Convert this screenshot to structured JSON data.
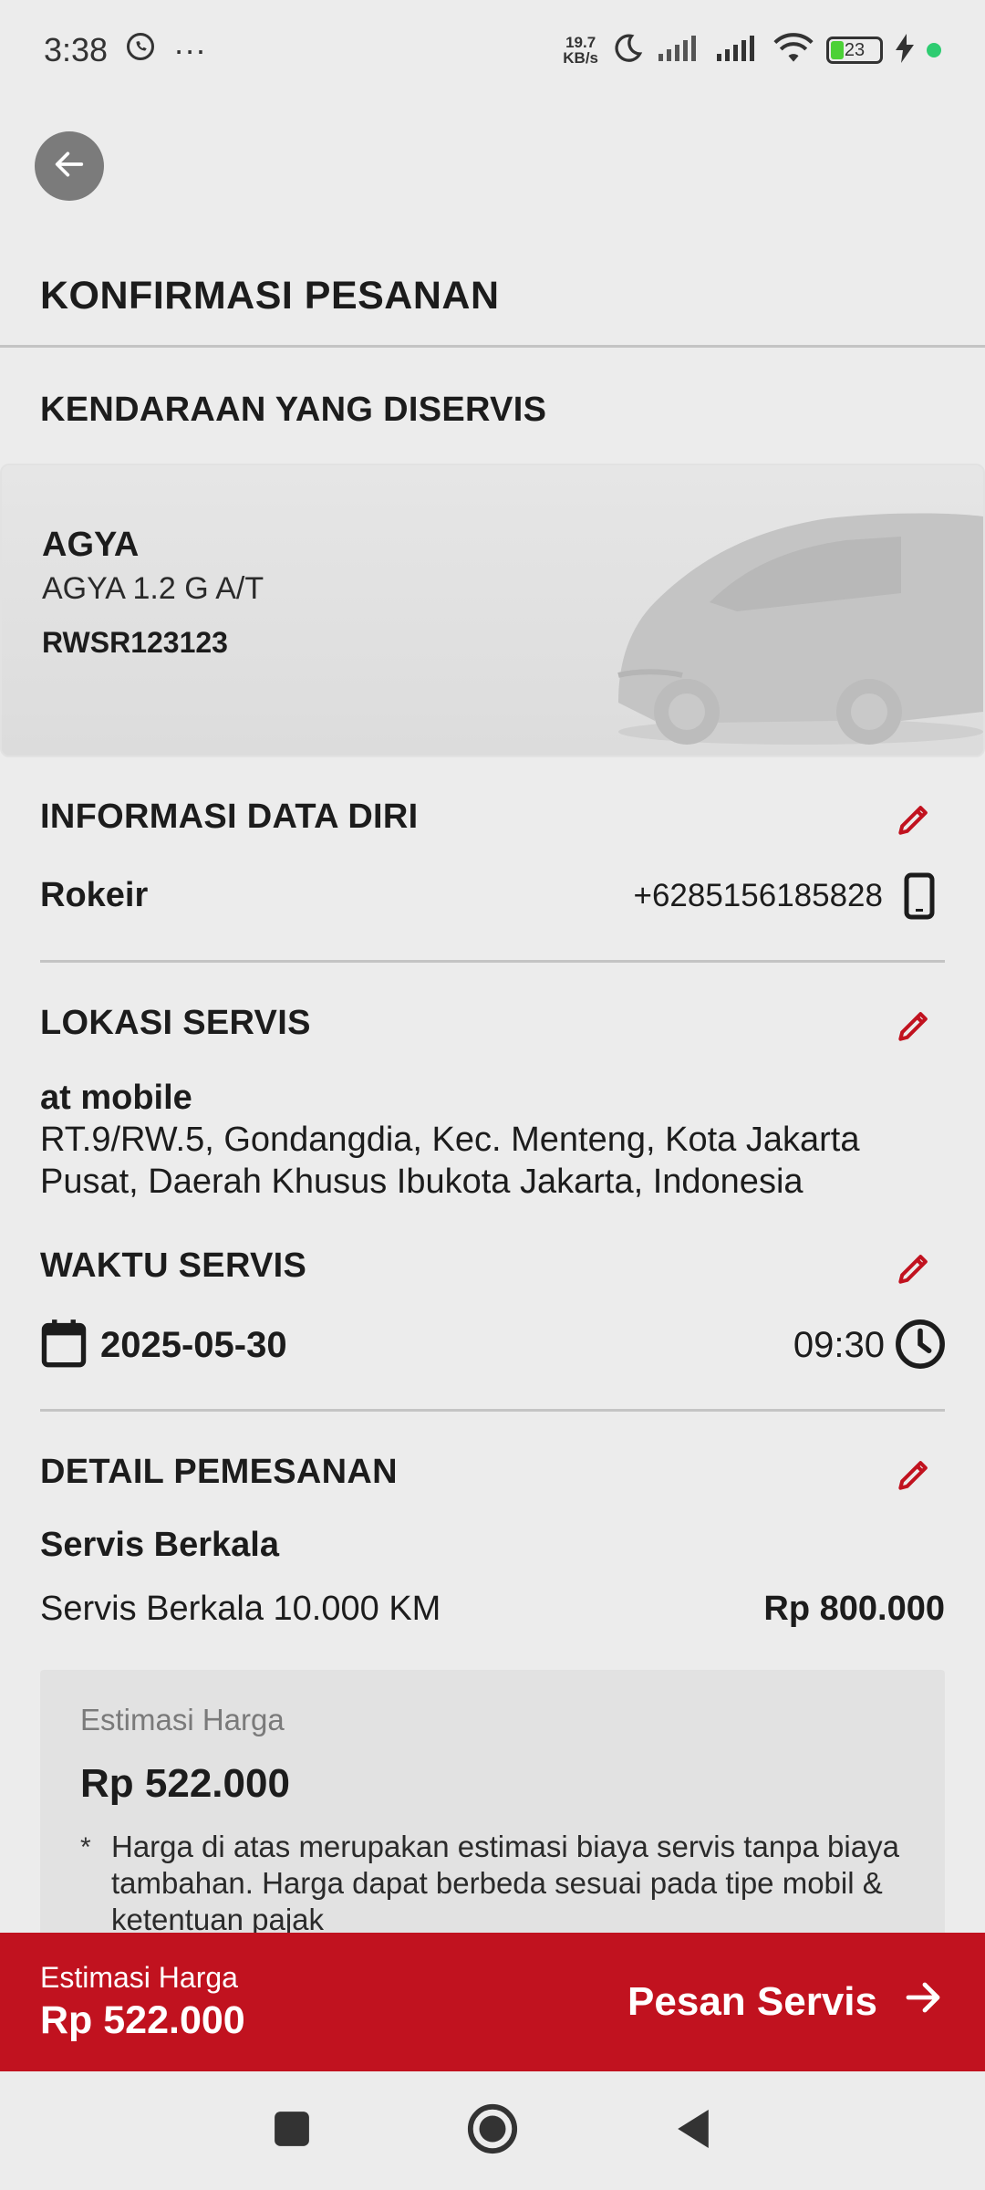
{
  "status_bar": {
    "time": "3:38",
    "more": "···",
    "net_speed_value": "19.7",
    "net_speed_unit": "KB/s",
    "battery": "23"
  },
  "header": {
    "title": "KONFIRMASI PESANAN"
  },
  "vehicle": {
    "section_title": "KENDARAAN YANG DISERVIS",
    "model": "AGYA",
    "variant": "AGYA 1.2 G A/T",
    "plate": "RWSR123123"
  },
  "personal_info": {
    "section_title": "INFORMASI DATA DIRI",
    "name": "Rokeir",
    "phone": "+6285156185828"
  },
  "location": {
    "section_title": "LOKASI SERVIS",
    "place": "at mobile",
    "address_line1": "RT.9/RW.5, Gondangdia, Kec. Menteng, Kota Jakarta",
    "address_line2": "Pusat, Daerah Khusus Ibukota Jakarta, Indonesia"
  },
  "service_time": {
    "section_title": "WAKTU SERVIS",
    "date": "2025-05-30",
    "time": "09:30"
  },
  "order_detail": {
    "section_title": "DETAIL PEMESANAN",
    "service_type": "Servis Berkala",
    "item_name": "Servis Berkala 10.000 KM",
    "item_price": "Rp 800.000"
  },
  "estimate": {
    "label": "Estimasi Harga",
    "value": "Rp 522.000",
    "note_marker": "*",
    "note": "Harga di atas merupakan estimasi biaya servis tanpa biaya tambahan. Harga dapat berbeda sesuai pada tipe mobil & ketentuan pajak"
  },
  "bottom_bar": {
    "label": "Estimasi Harga",
    "value": "Rp 522.000",
    "button_label": "Pesan Servis"
  },
  "colors": {
    "accent": "#c1121f",
    "background": "#ececec"
  }
}
